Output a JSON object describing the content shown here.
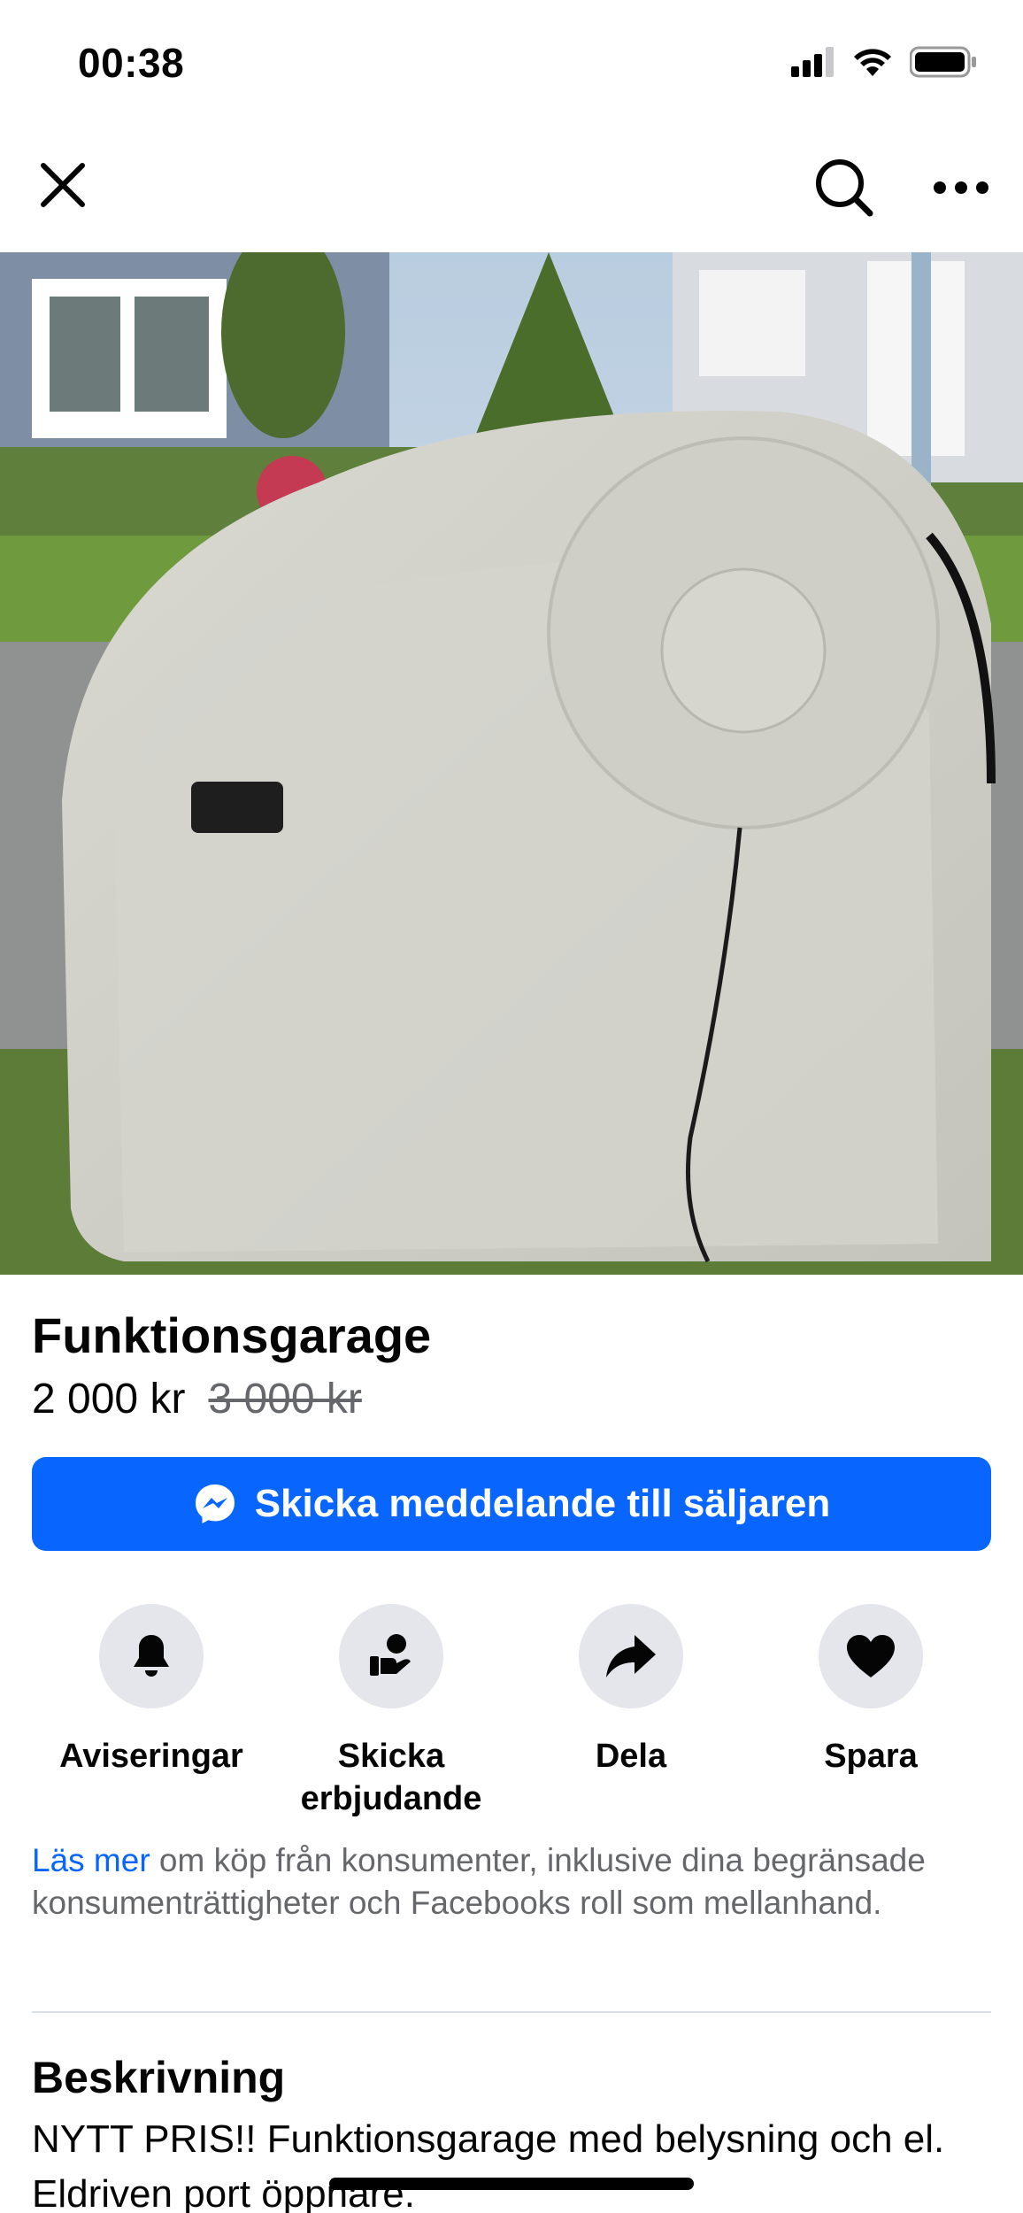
{
  "status_bar": {
    "time": "00:38",
    "icons": [
      "signal-icon",
      "wifi-icon",
      "battery-icon"
    ]
  },
  "nav": {
    "icons": [
      "close-icon",
      "search-icon",
      "more-icon"
    ]
  },
  "photo": {
    "carousel_total": 3,
    "carousel_active": 1
  },
  "listing": {
    "title": "Funktionsgarage",
    "price": "2 000 kr",
    "old_price": "3 000 kr"
  },
  "message_button": {
    "label": "Skicka meddelande till säljaren",
    "icon": "messenger-icon",
    "color": "#0866ff"
  },
  "actions": [
    {
      "label": "Aviseringar",
      "icon": "bell-icon"
    },
    {
      "label": "Skicka erbjudande",
      "icon": "offer-icon"
    },
    {
      "label": "Dela",
      "icon": "share-icon"
    },
    {
      "label": "Spara",
      "icon": "heart-icon"
    }
  ],
  "disclaimer": {
    "link": "Läs mer",
    "text": " om köp från konsumenter, inklusive dina begränsade konsumenträttigheter och Facebooks roll som mellanhand."
  },
  "description": {
    "heading": "Beskrivning",
    "text": "NYTT PRIS!! Funktionsgarage med belysning och el. Eldriven port öppnare."
  }
}
